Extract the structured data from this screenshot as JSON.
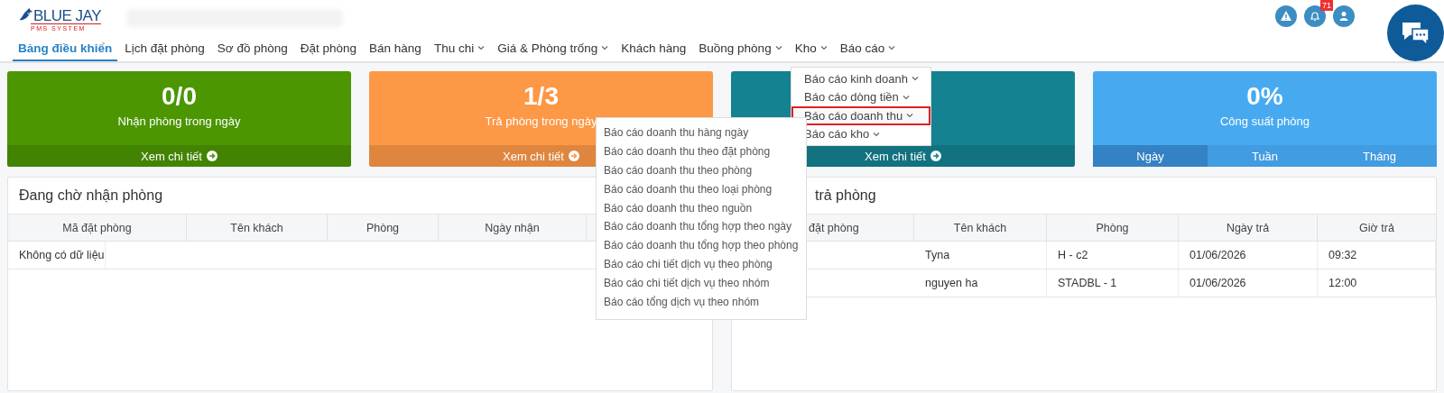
{
  "header": {
    "logo": {
      "title": "BLUE JAY",
      "subtitle": "PMS SYSTEM"
    },
    "notification_count": "71"
  },
  "nav": {
    "items": [
      {
        "label": "Bảng điều khiển",
        "selected": true,
        "has_menu": false
      },
      {
        "label": "Lịch đặt phòng",
        "selected": false,
        "has_menu": false
      },
      {
        "label": "Sơ đồ phòng",
        "selected": false,
        "has_menu": false
      },
      {
        "label": "Đặt phòng",
        "selected": false,
        "has_menu": false
      },
      {
        "label": "Bán hàng",
        "selected": false,
        "has_menu": false
      },
      {
        "label": "Thu chi",
        "selected": false,
        "has_menu": true
      },
      {
        "label": "Giá & Phòng trống",
        "selected": false,
        "has_menu": true
      },
      {
        "label": "Khách hàng",
        "selected": false,
        "has_menu": false
      },
      {
        "label": "Buồng phòng",
        "selected": false,
        "has_menu": true
      },
      {
        "label": "Kho",
        "selected": false,
        "has_menu": true
      },
      {
        "label": "Báo cáo",
        "selected": false,
        "has_menu": true
      }
    ]
  },
  "cards": [
    {
      "kind": "link",
      "color": "#4b9601",
      "value": "0/0",
      "label": "Nhận phòng trong ngày",
      "footer": "Xem chi tiết"
    },
    {
      "kind": "link",
      "color": "#fd9846",
      "value": "1/3",
      "label": "Trả phòng trong ngày",
      "footer": "Xem chi tiết"
    },
    {
      "kind": "link",
      "color": "#148290",
      "footer": "Xem chi tiết"
    },
    {
      "kind": "tabs",
      "color": "#47aaf0",
      "value": "0%",
      "label": "Công suất phòng",
      "tabs": [
        {
          "label": "Ngày",
          "selected": true
        },
        {
          "label": "Tuần",
          "selected": false
        },
        {
          "label": "Tháng",
          "selected": false
        }
      ]
    }
  ],
  "panels": [
    {
      "title": "Đang chờ nhận phòng",
      "columns": [
        "Mã đặt phòng",
        "Tên khách",
        "Phòng",
        "Ngày nhận"
      ],
      "empty_text": "Không có dữ liệu"
    },
    {
      "title": "trả phòng",
      "columns": [
        "đặt phòng",
        "Tên khách",
        "Phòng",
        "Ngày trả",
        "Giờ trả"
      ],
      "rows": [
        [
          "Tyna",
          "H - c2",
          "01/06/2026",
          "09:32"
        ],
        [
          "nguyen ha",
          "STADBL - 1",
          "01/06/2026",
          "12:00"
        ]
      ]
    }
  ],
  "report_menu": {
    "items": [
      {
        "label": "Báo cáo kinh doanh",
        "selected": false
      },
      {
        "label": "Báo cáo dòng tiền",
        "selected": false
      },
      {
        "label": "Báo cáo doanh thu",
        "selected": true
      },
      {
        "label": "Báo cáo kho",
        "selected": false
      }
    ]
  },
  "revenue_submenu": {
    "items": [
      "Báo cáo doanh thu hàng ngày",
      "Báo cáo doanh thu theo đặt phòng",
      "Báo cáo doanh thu theo phòng",
      "Báo cáo doanh thu theo loại phòng",
      "Báo cáo doanh thu theo nguồn",
      "Báo cáo doanh thu tổng hợp theo ngày",
      "Báo cáo doanh thu tổng hợp theo phòng",
      "Báo cáo chi tiết dịch vụ theo phòng",
      "Báo cáo chi tiết dịch vụ theo nhóm",
      "Báo cáo tổng dịch vụ theo nhóm"
    ]
  }
}
